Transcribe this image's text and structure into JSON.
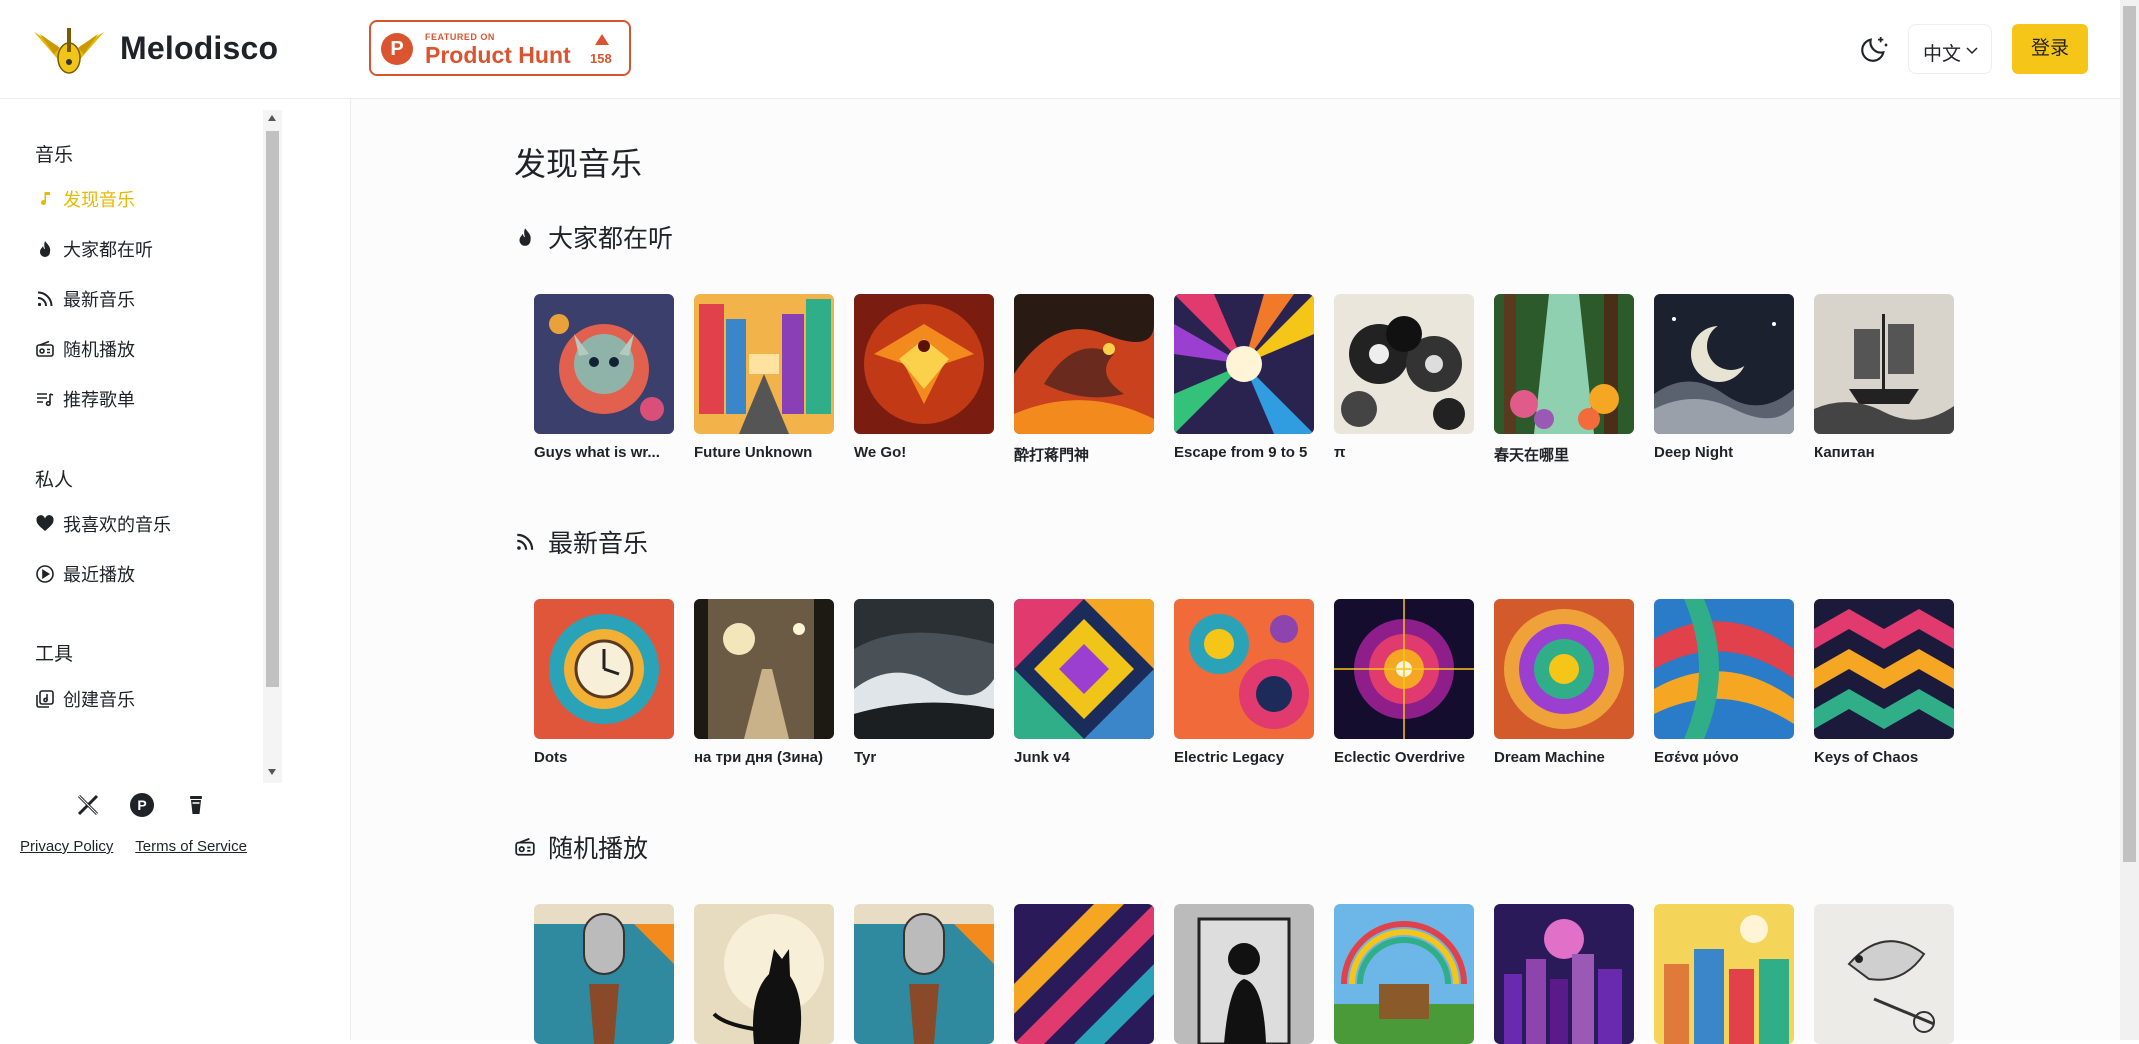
{
  "header": {
    "brand": "Melodisco",
    "product_hunt": {
      "featured": "FEATURED ON",
      "name": "Product Hunt",
      "votes": "158"
    },
    "language": "中文",
    "login_label": "登录"
  },
  "sidebar": {
    "sections": [
      {
        "title": "音乐",
        "items": [
          {
            "label": "发现音乐",
            "icon": "music-note-icon",
            "active": true
          },
          {
            "label": "大家都在听",
            "icon": "flame-icon"
          },
          {
            "label": "最新音乐",
            "icon": "rss-icon"
          },
          {
            "label": "随机播放",
            "icon": "radio-icon"
          },
          {
            "label": "推荐歌单",
            "icon": "playlist-icon"
          }
        ]
      },
      {
        "title": "私人",
        "items": [
          {
            "label": "我喜欢的音乐",
            "icon": "heart-icon"
          },
          {
            "label": "最近播放",
            "icon": "play-circle-icon"
          }
        ]
      },
      {
        "title": "工具",
        "items": [
          {
            "label": "创建音乐",
            "icon": "create-music-icon"
          }
        ]
      }
    ],
    "social_icons": [
      "x-icon",
      "producthunt-icon",
      "coffee-icon"
    ],
    "footer": {
      "privacy": "Privacy Policy",
      "terms": "Terms of Service"
    }
  },
  "main": {
    "title": "发现音乐",
    "sections": [
      {
        "title": "大家都在听",
        "icon": "flame-icon",
        "songs": [
          "Guys what is wr...",
          "Future Unknown",
          "We Go!",
          "酔打蒋門神",
          "Escape from 9 to 5",
          "π",
          "春天在哪里",
          "Deep Night",
          "Капитан"
        ]
      },
      {
        "title": "最新音乐",
        "icon": "rss-icon",
        "songs": [
          "Dots",
          "на три дня (Зина)",
          "Tyr",
          "Junk v4",
          "Electric Legacy",
          "Eclectic Overdrive",
          "Dream Machine",
          "Εσένα μόνο",
          "Keys of Chaos"
        ]
      },
      {
        "title": "随机播放",
        "icon": "radio-icon",
        "songs": [
          "",
          "",
          "",
          "",
          "",
          "",
          "",
          "",
          ""
        ]
      }
    ]
  },
  "colors": {
    "accent": "#f5c518",
    "active_nav": "#e7b900",
    "product_hunt": "#da552f"
  }
}
